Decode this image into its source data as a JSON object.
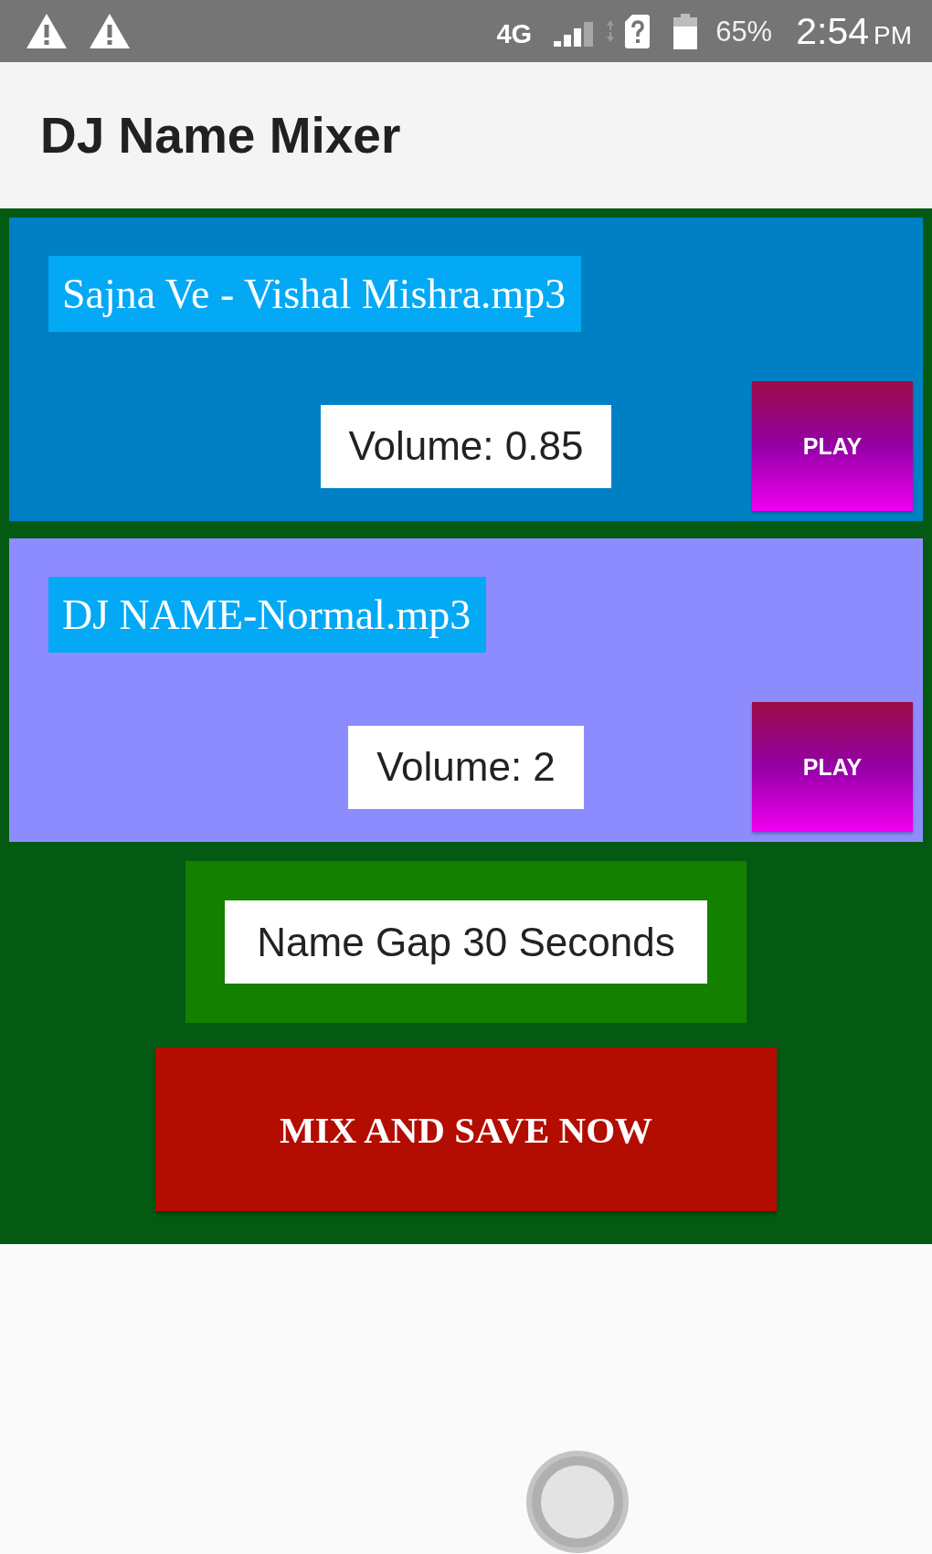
{
  "status_bar": {
    "network": "4G",
    "battery": "65%",
    "time": "2:54",
    "meridiem": "PM"
  },
  "app_bar": {
    "title": "DJ Name Mixer"
  },
  "tracks": [
    {
      "file": "Sajna Ve - Vishal Mishra.mp3",
      "volume": "Volume: 0.85",
      "button": "PLAY",
      "color": "#0080c4"
    },
    {
      "file": "DJ NAME-Normal.mp3",
      "volume": "Volume: 2",
      "button": "PLAY",
      "color": "#8c8cff"
    }
  ],
  "name_gap": {
    "label": "Name Gap 30 Seconds"
  },
  "mix_button": {
    "label": "MIX AND SAVE NOW"
  }
}
